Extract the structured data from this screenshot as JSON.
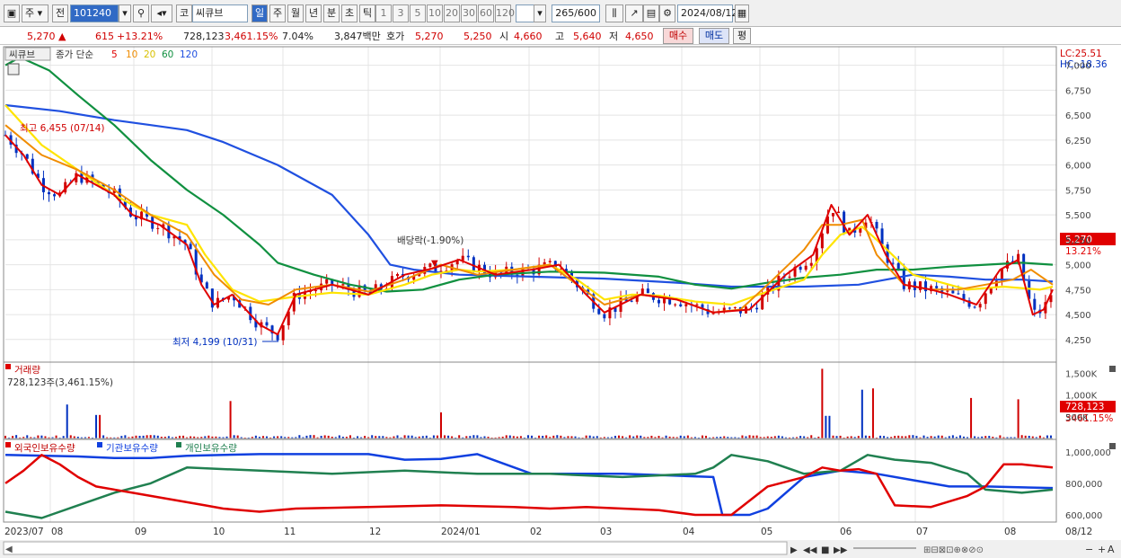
{
  "toolbar": {
    "type_label": "주",
    "mode_label": "전",
    "code": "101240",
    "market_label": "코",
    "name": "씨큐브",
    "periods": [
      "일",
      "주",
      "월",
      "년",
      "분",
      "초",
      "틱"
    ],
    "active_period": "일",
    "intervals": [
      "1",
      "3",
      "5",
      "10",
      "20",
      "30",
      "60",
      "120"
    ],
    "count": "265",
    "count_total": "/600",
    "date": "2024/08/12"
  },
  "quote": {
    "price": "5,270",
    "change": "615",
    "change_pct": "+13.21%",
    "volume": "728,123",
    "volume_pct": "3,461.15%",
    "turnover": "7.04%",
    "amount": "3,847백만",
    "hoga_label": "호가",
    "hoga": "5,270",
    "hoga2": "5,250",
    "open_label": "시",
    "open": "4,660",
    "high_label": "고",
    "high": "5,640",
    "low_label": "저",
    "low": "4,650",
    "buy_label": "매수",
    "sell_label": "매도",
    "eval_label": "평"
  },
  "price_panel": {
    "stock_tag": "씨큐브",
    "indicator_label": "종가 단순",
    "ma_periods": [
      "5",
      "10",
      "20",
      "60",
      "120"
    ],
    "lc": "LC:25.51",
    "hc": "HC:-18.36",
    "last_price": "5,270",
    "last_pct": "13.21%",
    "y_ticks": [
      "7,000",
      "6,750",
      "6,500",
      "6,250",
      "6,000",
      "5,750",
      "5,500",
      "5,250",
      "5,000",
      "4,750",
      "4,500",
      "4,250"
    ],
    "high_annot": "최고 6,455 (07/14)",
    "low_annot": "최저 4,199 (10/31)",
    "dividend_annot": "배당락(-1.90%)"
  },
  "volume_panel": {
    "title": "거래량",
    "value_text": "728,123주(3,461.15%)",
    "y_ticks": [
      "1,500K",
      "1,000K",
      "500K"
    ],
    "last_value": "728,123",
    "last_pct": "3461.15%"
  },
  "holdings_panel": {
    "legend": [
      "외국인보유수량",
      "기관보유수량",
      "개인보유수량"
    ],
    "y_ticks": [
      "1,000,000",
      "800,000",
      "600,000"
    ]
  },
  "x_axis": {
    "labels": [
      "2023/07",
      "08",
      "09",
      "10",
      "11",
      "12",
      "2024/01",
      "02",
      "03",
      "04",
      "05",
      "06",
      "07",
      "08"
    ],
    "right_label": "08/12"
  },
  "colors": {
    "up": "#d00000",
    "down": "#0030c0",
    "ma5": "#e00000",
    "ma10": "#f08c00",
    "ma20": "#ffe400",
    "ma60": "#109040",
    "ma120": "#2050e0",
    "foreign": "#e00000",
    "institution": "#1040e0",
    "individual": "#208050"
  },
  "chart_data": {
    "type": "line",
    "ma120": [
      [
        0,
        6600
      ],
      [
        30,
        6540
      ],
      [
        60,
        6450
      ],
      [
        80,
        6400
      ],
      [
        100,
        6350
      ],
      [
        120,
        6230
      ],
      [
        150,
        6000
      ],
      [
        180,
        5700
      ],
      [
        200,
        5300
      ],
      [
        212,
        5000
      ],
      [
        225,
        4950
      ],
      [
        250,
        4900
      ],
      [
        290,
        4880
      ],
      [
        330,
        4860
      ],
      [
        370,
        4820
      ],
      [
        400,
        4780
      ],
      [
        410,
        4780
      ],
      [
        440,
        4780
      ],
      [
        470,
        4800
      ],
      [
        500,
        4900
      ],
      [
        520,
        4880
      ],
      [
        540,
        4850
      ],
      [
        560,
        4850
      ],
      [
        577,
        4830
      ]
    ],
    "ma60": [
      [
        0,
        7000
      ],
      [
        8,
        7080
      ],
      [
        24,
        6950
      ],
      [
        40,
        6700
      ],
      [
        60,
        6400
      ],
      [
        80,
        6050
      ],
      [
        100,
        5750
      ],
      [
        120,
        5500
      ],
      [
        140,
        5200
      ],
      [
        150,
        5020
      ],
      [
        170,
        4900
      ],
      [
        190,
        4800
      ],
      [
        210,
        4730
      ],
      [
        230,
        4750
      ],
      [
        250,
        4850
      ],
      [
        270,
        4900
      ],
      [
        300,
        4930
      ],
      [
        330,
        4920
      ],
      [
        360,
        4880
      ],
      [
        380,
        4800
      ],
      [
        400,
        4760
      ],
      [
        420,
        4820
      ],
      [
        440,
        4870
      ],
      [
        460,
        4900
      ],
      [
        480,
        4950
      ],
      [
        500,
        4950
      ],
      [
        520,
        4980
      ],
      [
        540,
        5000
      ],
      [
        560,
        5020
      ],
      [
        577,
        5000
      ]
    ],
    "ma20": [
      [
        0,
        6600
      ],
      [
        20,
        6200
      ],
      [
        40,
        5950
      ],
      [
        60,
        5700
      ],
      [
        80,
        5500
      ],
      [
        100,
        5400
      ],
      [
        110,
        5100
      ],
      [
        125,
        4750
      ],
      [
        140,
        4630
      ],
      [
        160,
        4680
      ],
      [
        180,
        4720
      ],
      [
        200,
        4700
      ],
      [
        220,
        4800
      ],
      [
        235,
        4900
      ],
      [
        250,
        4950
      ],
      [
        260,
        4930
      ],
      [
        280,
        4950
      ],
      [
        300,
        5000
      ],
      [
        315,
        4850
      ],
      [
        330,
        4650
      ],
      [
        345,
        4700
      ],
      [
        360,
        4690
      ],
      [
        380,
        4630
      ],
      [
        400,
        4600
      ],
      [
        415,
        4700
      ],
      [
        440,
        4850
      ],
      [
        450,
        5100
      ],
      [
        460,
        5300
      ],
      [
        472,
        5380
      ],
      [
        480,
        5250
      ],
      [
        500,
        4900
      ],
      [
        520,
        4800
      ],
      [
        530,
        4750
      ],
      [
        550,
        4780
      ],
      [
        570,
        4750
      ],
      [
        577,
        4780
      ]
    ],
    "ma10": [
      [
        0,
        6400
      ],
      [
        20,
        6100
      ],
      [
        40,
        5950
      ],
      [
        60,
        5750
      ],
      [
        80,
        5500
      ],
      [
        100,
        5300
      ],
      [
        115,
        4900
      ],
      [
        130,
        4650
      ],
      [
        145,
        4600
      ],
      [
        160,
        4750
      ],
      [
        180,
        4800
      ],
      [
        200,
        4730
      ],
      [
        220,
        4850
      ],
      [
        240,
        5000
      ],
      [
        260,
        4900
      ],
      [
        280,
        4950
      ],
      [
        300,
        5000
      ],
      [
        315,
        4800
      ],
      [
        330,
        4600
      ],
      [
        350,
        4700
      ],
      [
        370,
        4650
      ],
      [
        390,
        4520
      ],
      [
        405,
        4550
      ],
      [
        420,
        4800
      ],
      [
        440,
        5150
      ],
      [
        450,
        5400
      ],
      [
        460,
        5400
      ],
      [
        472,
        5450
      ],
      [
        480,
        5100
      ],
      [
        495,
        4800
      ],
      [
        510,
        4750
      ],
      [
        525,
        4750
      ],
      [
        540,
        4800
      ],
      [
        555,
        4850
      ],
      [
        565,
        4950
      ],
      [
        577,
        4800
      ]
    ],
    "ma5": [
      [
        0,
        6300
      ],
      [
        10,
        6100
      ],
      [
        20,
        5800
      ],
      [
        30,
        5700
      ],
      [
        40,
        5900
      ],
      [
        60,
        5700
      ],
      [
        70,
        5500
      ],
      [
        85,
        5400
      ],
      [
        100,
        5200
      ],
      [
        108,
        4800
      ],
      [
        115,
        4600
      ],
      [
        125,
        4700
      ],
      [
        140,
        4400
      ],
      [
        150,
        4300
      ],
      [
        160,
        4700
      ],
      [
        180,
        4800
      ],
      [
        200,
        4700
      ],
      [
        220,
        4900
      ],
      [
        235,
        4960
      ],
      [
        250,
        5050
      ],
      [
        270,
        4900
      ],
      [
        290,
        4950
      ],
      [
        305,
        5000
      ],
      [
        320,
        4700
      ],
      [
        330,
        4520
      ],
      [
        350,
        4700
      ],
      [
        370,
        4650
      ],
      [
        390,
        4520
      ],
      [
        410,
        4550
      ],
      [
        430,
        4900
      ],
      [
        445,
        5100
      ],
      [
        455,
        5600
      ],
      [
        465,
        5300
      ],
      [
        475,
        5500
      ],
      [
        485,
        5100
      ],
      [
        495,
        4800
      ],
      [
        510,
        4750
      ],
      [
        520,
        4700
      ],
      [
        535,
        4600
      ],
      [
        548,
        4950
      ],
      [
        558,
        5050
      ],
      [
        566,
        4500
      ],
      [
        572,
        4550
      ],
      [
        577,
        4750
      ]
    ],
    "foreign": [
      [
        0,
        800000
      ],
      [
        10,
        880000
      ],
      [
        20,
        980000
      ],
      [
        30,
        920000
      ],
      [
        40,
        840000
      ],
      [
        50,
        780000
      ],
      [
        70,
        740000
      ],
      [
        90,
        700000
      ],
      [
        110,
        660000
      ],
      [
        120,
        640000
      ],
      [
        140,
        620000
      ],
      [
        160,
        640000
      ],
      [
        200,
        650000
      ],
      [
        240,
        660000
      ],
      [
        280,
        650000
      ],
      [
        300,
        640000
      ],
      [
        320,
        650000
      ],
      [
        360,
        630000
      ],
      [
        380,
        600000
      ],
      [
        400,
        600000
      ],
      [
        420,
        780000
      ],
      [
        440,
        840000
      ],
      [
        450,
        900000
      ],
      [
        460,
        880000
      ],
      [
        470,
        890000
      ],
      [
        480,
        860000
      ],
      [
        490,
        660000
      ],
      [
        510,
        650000
      ],
      [
        530,
        720000
      ],
      [
        540,
        780000
      ],
      [
        550,
        920000
      ],
      [
        560,
        920000
      ],
      [
        577,
        900000
      ]
    ],
    "institution": [
      [
        0,
        980000
      ],
      [
        40,
        970000
      ],
      [
        60,
        960000
      ],
      [
        80,
        960000
      ],
      [
        100,
        975000
      ],
      [
        140,
        985000
      ],
      [
        200,
        985000
      ],
      [
        220,
        950000
      ],
      [
        240,
        955000
      ],
      [
        260,
        985000
      ],
      [
        290,
        860000
      ],
      [
        340,
        860000
      ],
      [
        390,
        840000
      ],
      [
        395,
        600000
      ],
      [
        410,
        600000
      ],
      [
        420,
        640000
      ],
      [
        440,
        840000
      ],
      [
        460,
        880000
      ],
      [
        480,
        860000
      ],
      [
        500,
        820000
      ],
      [
        520,
        780000
      ],
      [
        540,
        780000
      ],
      [
        577,
        770000
      ]
    ],
    "individual": [
      [
        0,
        620000
      ],
      [
        20,
        580000
      ],
      [
        40,
        660000
      ],
      [
        60,
        740000
      ],
      [
        80,
        800000
      ],
      [
        100,
        900000
      ],
      [
        140,
        880000
      ],
      [
        180,
        860000
      ],
      [
        220,
        880000
      ],
      [
        260,
        860000
      ],
      [
        300,
        860000
      ],
      [
        340,
        840000
      ],
      [
        380,
        860000
      ],
      [
        390,
        900000
      ],
      [
        400,
        980000
      ],
      [
        420,
        940000
      ],
      [
        440,
        860000
      ],
      [
        460,
        880000
      ],
      [
        475,
        980000
      ],
      [
        490,
        950000
      ],
      [
        510,
        930000
      ],
      [
        530,
        860000
      ],
      [
        540,
        760000
      ],
      [
        560,
        740000
      ],
      [
        577,
        760000
      ]
    ]
  }
}
